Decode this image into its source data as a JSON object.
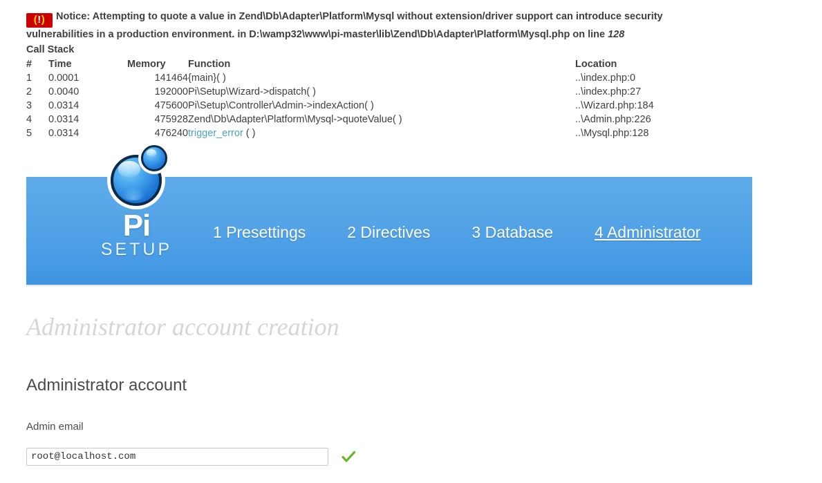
{
  "notice": {
    "icon_name": "xdebug-error-icon",
    "icon_glyph": "( ! )",
    "line1": "Notice: Attempting to quote a value in Zend\\Db\\Adapter\\Platform\\Mysql without extension/driver support can introduce security",
    "line2_before": "vulnerabilities in a production environment. in D:\\wamp32\\www\\pi-master\\lib\\Zend\\Db\\Adapter\\Platform\\Mysql.php on line ",
    "line_number": "128"
  },
  "call_stack": {
    "title": "Call Stack",
    "headers": {
      "num": "#",
      "time": "Time",
      "memory": "Memory",
      "function": "Function",
      "location": "Location"
    },
    "rows": [
      {
        "num": "1",
        "time": "0.0001",
        "memory": "141464",
        "function": "{main}( )",
        "function_link": "",
        "function_tail": "",
        "location": "..\\index.php:0"
      },
      {
        "num": "2",
        "time": "0.0040",
        "memory": "192000",
        "function": "Pi\\Setup\\Wizard->dispatch( )",
        "function_link": "",
        "function_tail": "",
        "location": "..\\index.php:27"
      },
      {
        "num": "3",
        "time": "0.0314",
        "memory": "475600",
        "function": "Pi\\Setup\\Controller\\Admin->indexAction( )",
        "function_link": "",
        "function_tail": "",
        "location": "..\\Wizard.php:184"
      },
      {
        "num": "4",
        "time": "0.0314",
        "memory": "475928",
        "function": "Zend\\Db\\Adapter\\Platform\\Mysql->quoteValue( )",
        "function_link": "",
        "function_tail": "",
        "location": "..\\Admin.php:226"
      },
      {
        "num": "5",
        "time": "0.0314",
        "memory": "476240",
        "function": "",
        "function_link": "trigger_error",
        "function_tail": " ( )",
        "location": "..\\Mysql.php:128"
      }
    ]
  },
  "brand": {
    "logo_icon_name": "pi-spheres-logo-icon",
    "name": "Pi",
    "subtitle": "SETUP"
  },
  "nav": {
    "items": [
      {
        "label": "1 Presettings",
        "active": false
      },
      {
        "label": "2 Directives",
        "active": false
      },
      {
        "label": "3 Database",
        "active": false
      },
      {
        "label": "4 Administrator",
        "active": true
      }
    ]
  },
  "page": {
    "title": "Administrator account creation",
    "section_heading": "Administrator account"
  },
  "form": {
    "email_label": "Admin email",
    "email_value": "root@localhost.com",
    "email_placeholder": "root@localhost.com",
    "valid_icon_name": "green-check-icon"
  },
  "colors": {
    "header_blue_top": "#5dabe9",
    "header_blue_bottom": "#3f95e2",
    "notice_red": "#cc0000",
    "link_teal": "#4ba3b8",
    "check_green": "#6ab42f",
    "title_gray": "#d6d6d6"
  }
}
